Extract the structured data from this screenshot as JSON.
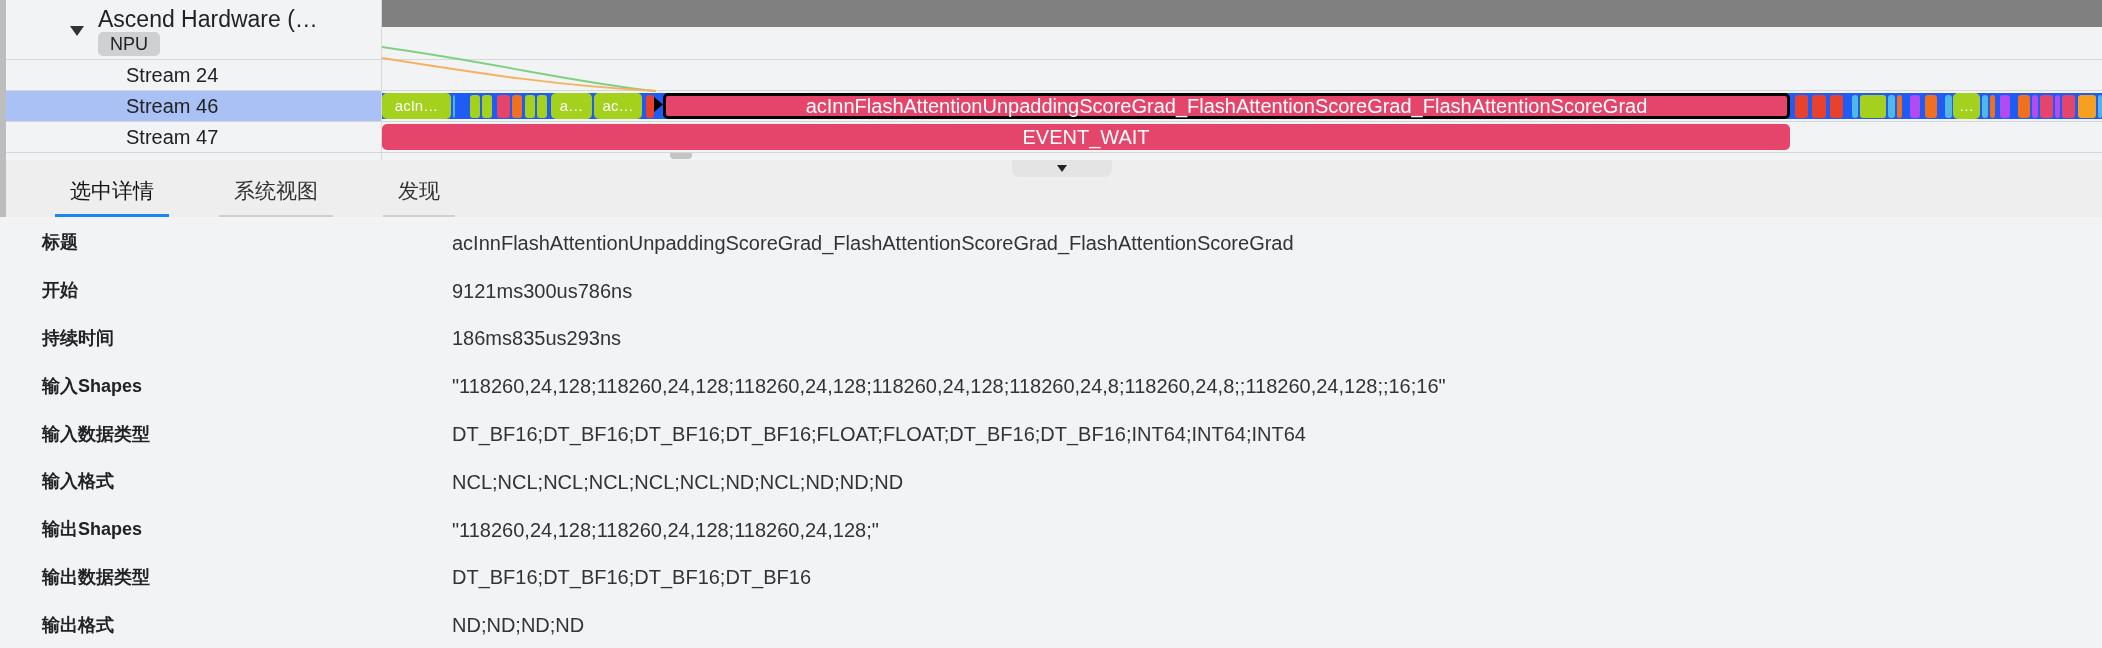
{
  "tree": {
    "group": {
      "title": "Ascend Hardware (…",
      "badge": "NPU",
      "expanded": true
    },
    "rows": [
      {
        "label": "Stream 24",
        "selected": false
      },
      {
        "label": "Stream 46",
        "selected": true,
        "slices": [
          {
            "label": "acIn…",
            "color": "#a3d11e",
            "selected": false
          },
          {
            "label": "a…",
            "color": "#a3d11e",
            "selected": false
          },
          {
            "label": "ac…",
            "color": "#a3d11e",
            "selected": false
          },
          {
            "label": "acInnFlashAttentionUnpaddingScoreGrad_FlashAttentionScoreGrad_FlashAttentionScoreGrad",
            "color": "#e5456a",
            "selected": true
          },
          {
            "label": "…",
            "color": "#a3d11e",
            "selected": false
          }
        ]
      },
      {
        "label": "Stream 47",
        "selected": false,
        "slices": [
          {
            "label": "EVENT_WAIT",
            "color": "#e5456a",
            "selected": false
          }
        ]
      }
    ]
  },
  "tabs": [
    {
      "label": "选中详情",
      "selected": true
    },
    {
      "label": "系统视图",
      "selected": false
    },
    {
      "label": "发现",
      "selected": false
    }
  ],
  "details": [
    {
      "label": "标题",
      "value": "acInnFlashAttentionUnpaddingScoreGrad_FlashAttentionScoreGrad_FlashAttentionScoreGrad"
    },
    {
      "label": "开始",
      "value": "9121ms300us786ns"
    },
    {
      "label": "持续时间",
      "value": "186ms835us293ns"
    },
    {
      "label": "输入Shapes",
      "value": "\"118260,24,128;118260,24,128;118260,24,128;118260,24,128;118260,24,8;118260,24,8;;118260,24,128;;16;16\""
    },
    {
      "label": "输入数据类型",
      "value": "DT_BF16;DT_BF16;DT_BF16;DT_BF16;FLOAT;FLOAT;DT_BF16;DT_BF16;INT64;INT64;INT64"
    },
    {
      "label": "输入格式",
      "value": "NCL;NCL;NCL;NCL;NCL;NCL;ND;NCL;ND;ND;ND"
    },
    {
      "label": "输出Shapes",
      "value": "\"118260,24,128;118260,24,128;118260,24,128;\""
    },
    {
      "label": "输出数据类型",
      "value": "DT_BF16;DT_BF16;DT_BF16;DT_BF16"
    },
    {
      "label": "输出格式",
      "value": "ND;ND;ND;ND"
    }
  ]
}
